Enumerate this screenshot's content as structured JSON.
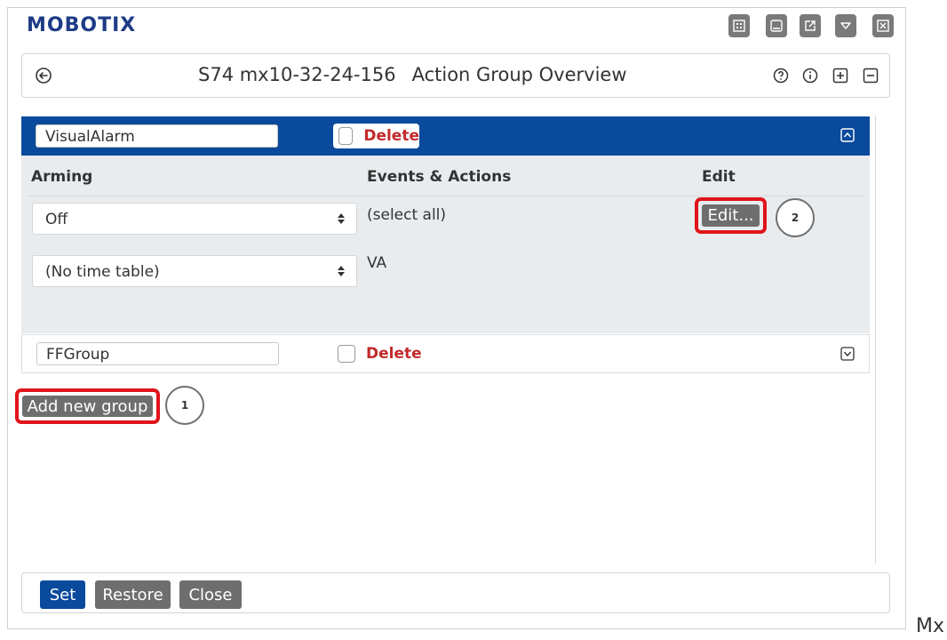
{
  "brand": "MOBOTIX",
  "window_buttons": [
    "grid-icon",
    "minimize-icon",
    "external-link-icon",
    "dropdown-icon",
    "close-icon"
  ],
  "header": {
    "device": "S74 mx10-32-24-156",
    "title": "Action Group Overview",
    "icons": [
      "help-icon",
      "info-icon",
      "expand-all-icon",
      "collapse-all-icon"
    ]
  },
  "groups": [
    {
      "name": "VisualAlarm",
      "delete_label": "Delete",
      "expanded": true,
      "columns": {
        "arming": "Arming",
        "events": "Events & Actions",
        "edit": "Edit"
      },
      "arming_value": "Off",
      "timetable_value": "(No time table)",
      "events": [
        "(select all)",
        "VA"
      ],
      "edit_button": "Edit...",
      "edit_badge": "2"
    },
    {
      "name": "FFGroup",
      "delete_label": "Delete",
      "expanded": false
    }
  ],
  "add_group": {
    "label": "Add new group",
    "badge": "1"
  },
  "footer": {
    "set": "Set",
    "restore": "Restore",
    "close": "Close"
  },
  "corner_label": "Mx",
  "colors": {
    "brand": "#1d3b86",
    "group_header": "#0a4a9c",
    "highlight": "#e0141a",
    "delete": "#c22a2a",
    "set_button": "#0a4a9c",
    "grey_button": "#6e6e6e"
  }
}
